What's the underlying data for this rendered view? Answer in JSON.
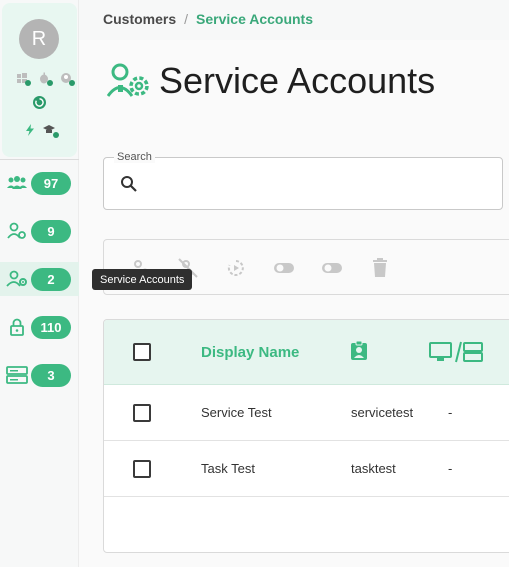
{
  "rail": {
    "avatar_letter": "R",
    "nav": [
      {
        "name": "users",
        "count": "97"
      },
      {
        "name": "user-settings",
        "count": "9"
      },
      {
        "name": "service-accounts",
        "count": "2"
      },
      {
        "name": "lock",
        "count": "110"
      },
      {
        "name": "servers",
        "count": "3"
      }
    ],
    "tooltip": "Service Accounts"
  },
  "breadcrumb": {
    "parent": "Customers",
    "separator": "/",
    "current": "Service Accounts"
  },
  "page": {
    "title": "Service Accounts"
  },
  "search": {
    "label": "Search",
    "placeholder": ""
  },
  "table": {
    "headers": {
      "display_name": "Display Name"
    },
    "rows": [
      {
        "display_name": "Service Test",
        "account": "servicetest",
        "computer": "-"
      },
      {
        "display_name": "Task Test",
        "account": "tasktest",
        "computer": "-"
      }
    ]
  },
  "colors": {
    "accent": "#3cb982",
    "accent_dark": "#2a9a6a",
    "header_bg": "#e6f5ef"
  }
}
